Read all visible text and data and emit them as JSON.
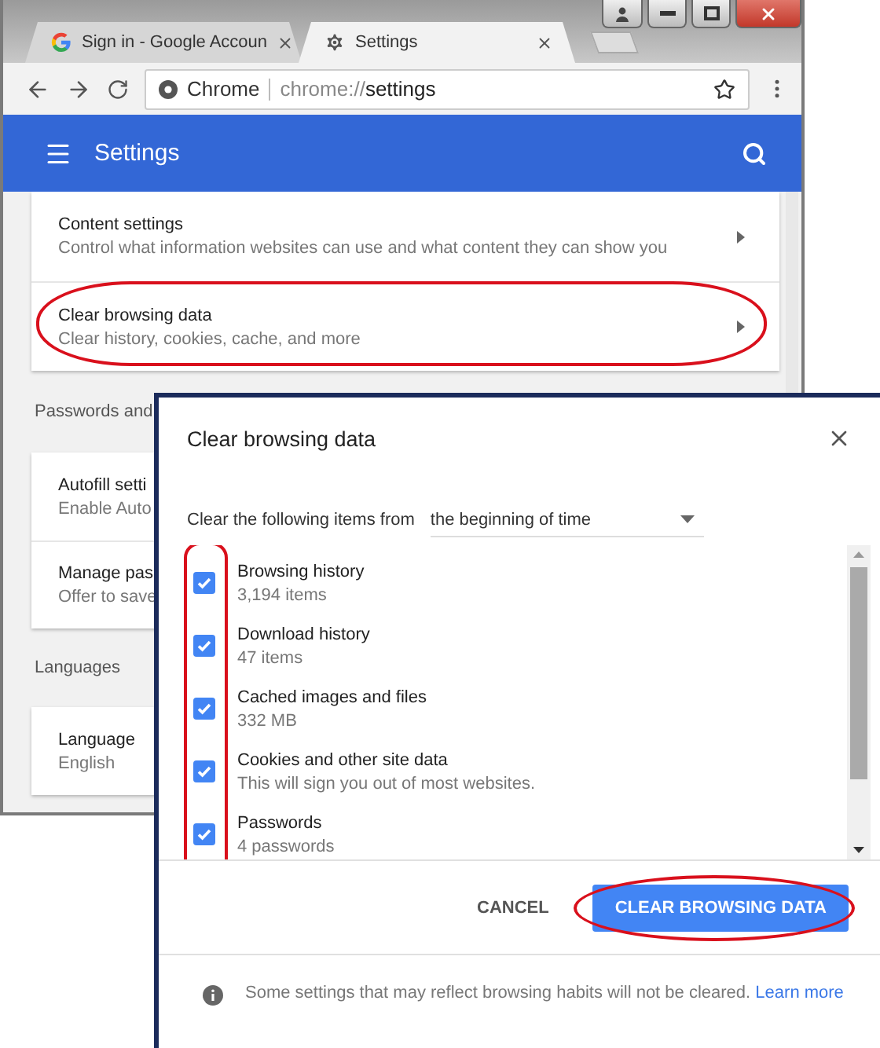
{
  "tabs": [
    {
      "title": "Sign in - Google Accoun",
      "kind": "google",
      "selected": false
    },
    {
      "title": "Settings",
      "kind": "settings",
      "selected": true
    }
  ],
  "address_bar": {
    "site_label": "Chrome",
    "scheme": "chrome://",
    "path": "settings"
  },
  "header": {
    "title": "Settings"
  },
  "privacy_rows": [
    {
      "title": "Content settings",
      "subtitle": "Control what information websites can use and what content they can show you",
      "circled": false
    },
    {
      "title": "Clear browsing data",
      "subtitle": "Clear history, cookies, cache, and more",
      "circled": true
    }
  ],
  "sections": [
    {
      "heading": "Passwords and",
      "rows": [
        {
          "title": "Autofill setti",
          "subtitle": "Enable Auto"
        },
        {
          "title": "Manage pas",
          "subtitle": "Offer to save"
        }
      ]
    },
    {
      "heading": "Languages",
      "rows": [
        {
          "title": "Language",
          "subtitle": "English"
        }
      ]
    }
  ],
  "dialog": {
    "title": "Clear browsing data",
    "range_label": "Clear the following items from",
    "range_value": "the beginning of time",
    "checkboxes_circled": true,
    "items": [
      {
        "label": "Browsing history",
        "detail": "3,194 items",
        "checked": true
      },
      {
        "label": "Download history",
        "detail": "47 items",
        "checked": true
      },
      {
        "label": "Cached images and files",
        "detail": "332 MB",
        "checked": true
      },
      {
        "label": "Cookies and other site data",
        "detail": "This will sign you out of most websites.",
        "checked": true
      },
      {
        "label": "Passwords",
        "detail": "4 passwords",
        "checked": true
      }
    ],
    "buttons": [
      {
        "label": "CANCEL",
        "kind": "text",
        "circled": false
      },
      {
        "label": "CLEAR BROWSING DATA",
        "kind": "primary",
        "circled": true
      }
    ],
    "info": {
      "text": "Some settings that may reflect browsing habits will not be cleared.",
      "link": "Learn more"
    }
  }
}
